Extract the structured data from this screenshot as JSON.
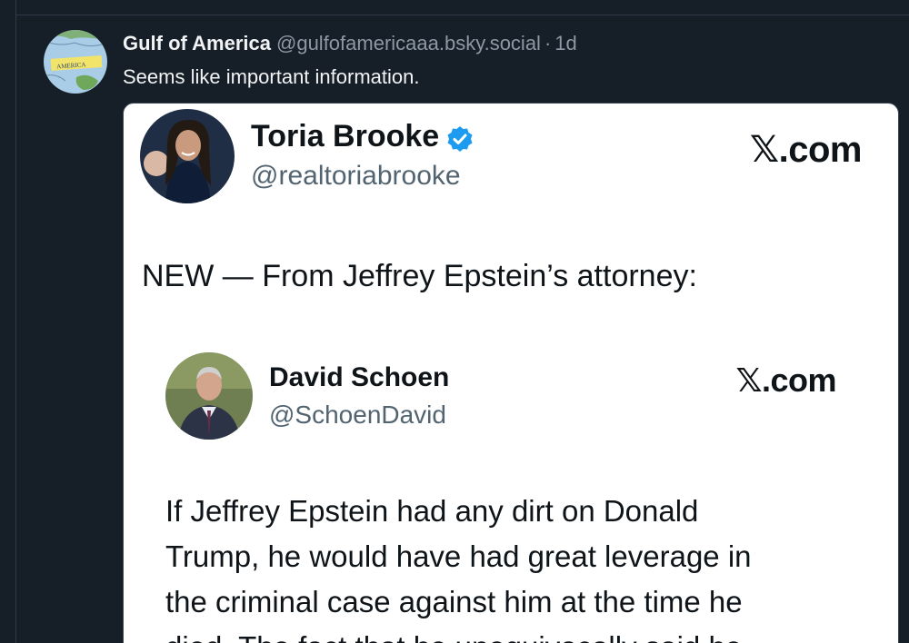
{
  "post": {
    "display_name": "Gulf of America",
    "handle": "@gulfofamericaaa.bsky.social",
    "separator": "·",
    "timestamp": "1d",
    "text": "Seems like important information.",
    "avatar_icon": "map-avatar-icon",
    "avatar_label": "AMERICA"
  },
  "embed": {
    "outer": {
      "name": "Toria Brooke",
      "handle": "@realtoriabrooke",
      "brand": "𝕏.com",
      "verified_icon": "verified-badge-icon",
      "text": "NEW — From Jeffrey Epstein’s attorney:"
    },
    "inner": {
      "name": "David Schoen",
      "handle": "@SchoenDavid",
      "brand": "𝕏.com",
      "lines": [
        "If Jeffrey Epstein had any dirt on Donald",
        "Trump, he would have had great leverage in",
        "the criminal case against him at the time he",
        "died. The fact that he unequivocally said he"
      ]
    }
  },
  "colors": {
    "background": "#161e27",
    "text_primary": "#f1f3f5",
    "text_secondary": "#8d98a5",
    "verified_blue": "#1d9bf0"
  }
}
